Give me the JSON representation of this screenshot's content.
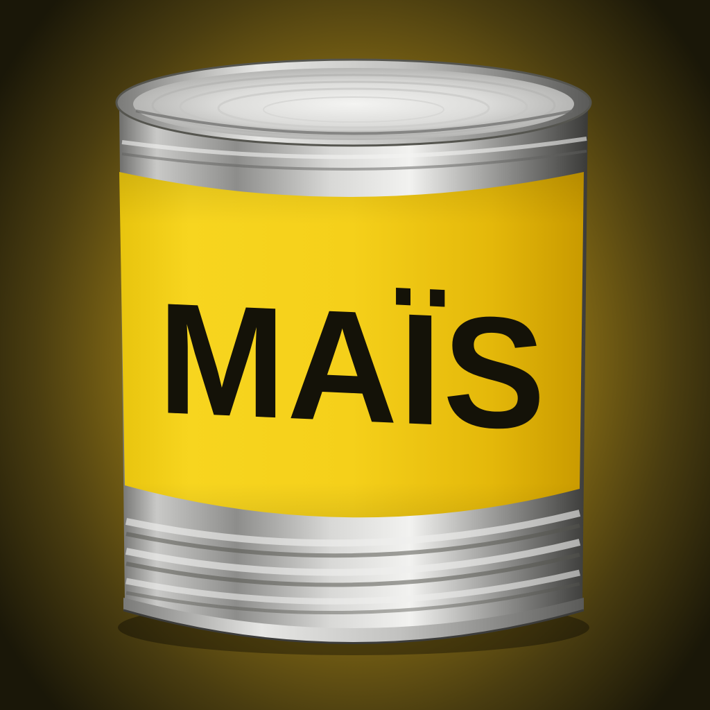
{
  "product": {
    "label_text": "MAÏS"
  },
  "colors": {
    "label_yellow": "#f6d21c",
    "label_yellow_dark": "#dcb000",
    "text": "#141208",
    "metal_light": "#e6e6e4",
    "metal_mid": "#a8a8a6",
    "metal_dark": "#4a4a48",
    "background": "#1a1708"
  }
}
